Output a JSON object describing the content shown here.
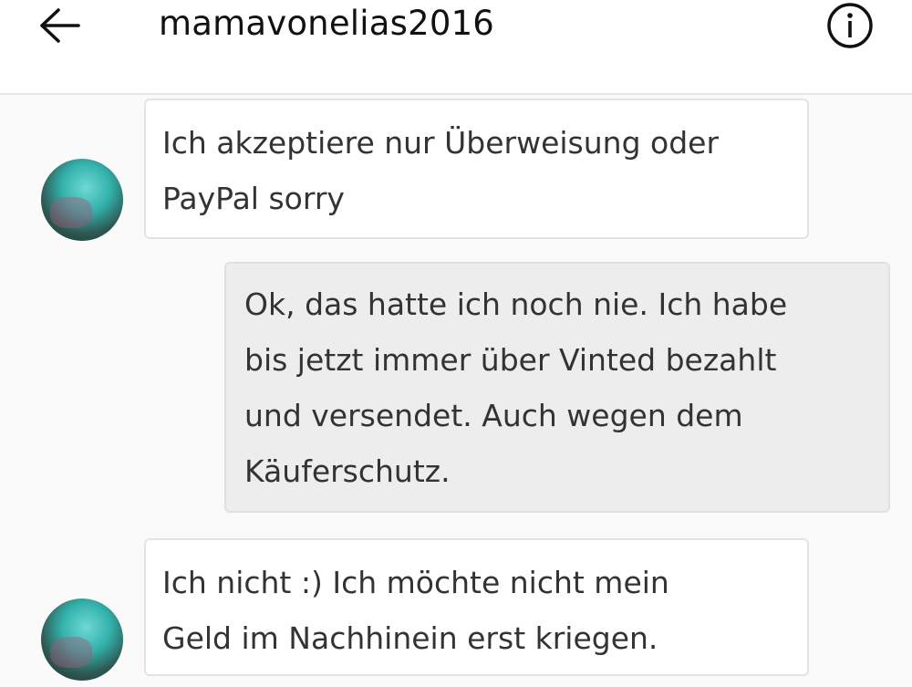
{
  "header": {
    "title": "mamavonelias2016",
    "back_icon": "arrow-left-icon",
    "info_icon": "info-icon"
  },
  "messages": [
    {
      "direction": "incoming",
      "lines": [
        "Ich akzeptiere nur Überweisung oder",
        "PayPal sorry"
      ]
    },
    {
      "direction": "outgoing",
      "lines": [
        "Ok, das hatte ich noch nie. Ich habe",
        "bis jetzt immer über Vinted bezahlt",
        "und versendet. Auch wegen dem",
        "Käuferschutz."
      ]
    },
    {
      "direction": "incoming",
      "lines": [
        "Ich nicht :) Ich möchte nicht mein",
        "Geld im Nachhinein erst kriegen."
      ]
    }
  ],
  "colors": {
    "background": "#fafafa",
    "incoming_bubble": "#ffffff",
    "outgoing_bubble": "#ededed",
    "text": "#333333"
  }
}
